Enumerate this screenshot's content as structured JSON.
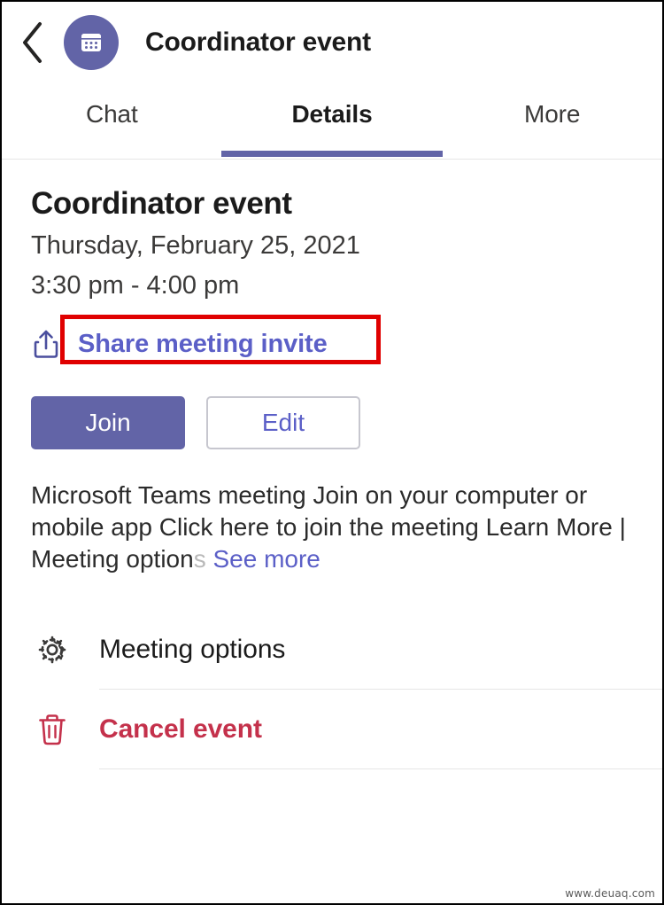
{
  "header": {
    "back_icon": "chevron-left-icon",
    "avatar_icon": "calendar-icon",
    "title": "Coordinator event"
  },
  "tabs": [
    {
      "label": "Chat",
      "active": false
    },
    {
      "label": "Details",
      "active": true
    },
    {
      "label": "More",
      "active": false
    }
  ],
  "event": {
    "title": "Coordinator event",
    "date": "Thursday, February 25, 2021",
    "time": "3:30 pm - 4:00 pm"
  },
  "share": {
    "icon": "share-upload-icon",
    "label": "Share meeting invite",
    "highlighted": true,
    "highlight_color": "#e00000"
  },
  "actions": {
    "join_label": "Join",
    "edit_label": "Edit"
  },
  "description": {
    "text": "Microsoft Teams meeting Join on your computer or mobile app Click here to join the meeting Learn More | Meeting option",
    "fade_tail": "s",
    "see_more_label": "See more"
  },
  "options": [
    {
      "icon": "gear-icon",
      "label": "Meeting options",
      "style": "dark"
    },
    {
      "icon": "trash-icon",
      "label": "Cancel event",
      "style": "danger"
    }
  ],
  "colors": {
    "brand_purple": "#6264a7",
    "link_purple": "#5b5fc7",
    "danger_red": "#c4314b",
    "highlight_red": "#e00000"
  },
  "watermark": "www.deuaq.com"
}
